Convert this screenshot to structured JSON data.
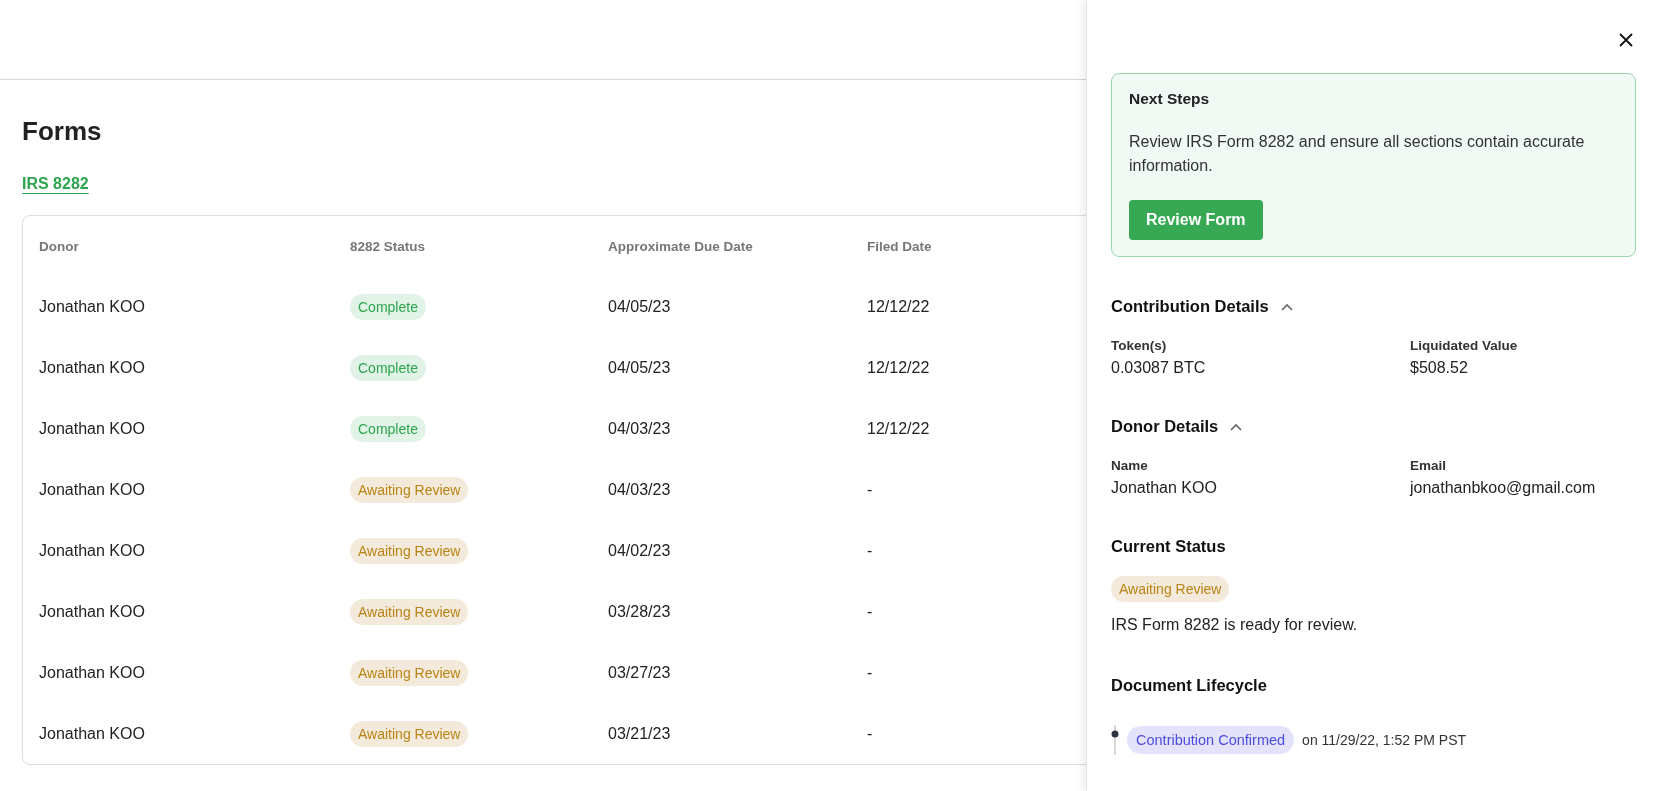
{
  "page": {
    "title": "Forms",
    "link": "IRS 8282"
  },
  "table": {
    "columns": [
      "Donor",
      "8282 Status",
      "Approximate Due Date",
      "Filed Date"
    ],
    "rows": [
      {
        "donor": "Jonathan KOO",
        "status": {
          "label": "Complete",
          "kind": "complete"
        },
        "due": "04/05/23",
        "filed": "12/12/22"
      },
      {
        "donor": "Jonathan KOO",
        "status": {
          "label": "Complete",
          "kind": "complete"
        },
        "due": "04/05/23",
        "filed": "12/12/22"
      },
      {
        "donor": "Jonathan KOO",
        "status": {
          "label": "Complete",
          "kind": "complete"
        },
        "due": "04/03/23",
        "filed": "12/12/22"
      },
      {
        "donor": "Jonathan KOO",
        "status": {
          "label": "Awaiting Review",
          "kind": "awaiting"
        },
        "due": "04/03/23",
        "filed": "-"
      },
      {
        "donor": "Jonathan KOO",
        "status": {
          "label": "Awaiting Review",
          "kind": "awaiting"
        },
        "due": "04/02/23",
        "filed": "-"
      },
      {
        "donor": "Jonathan KOO",
        "status": {
          "label": "Awaiting Review",
          "kind": "awaiting"
        },
        "due": "03/28/23",
        "filed": "-"
      },
      {
        "donor": "Jonathan KOO",
        "status": {
          "label": "Awaiting Review",
          "kind": "awaiting"
        },
        "due": "03/27/23",
        "filed": "-"
      },
      {
        "donor": "Jonathan KOO",
        "status": {
          "label": "Awaiting Review",
          "kind": "awaiting"
        },
        "due": "03/21/23",
        "filed": "-"
      }
    ]
  },
  "panel": {
    "next_steps": {
      "title": "Next Steps",
      "text": "Review IRS Form 8282 and ensure all sections contain accurate information.",
      "button": "Review Form"
    },
    "sections": [
      {
        "title": "Contribution Details",
        "expanded": true,
        "fields": [
          {
            "label": "Token(s)",
            "value": "0.03087 BTC"
          },
          {
            "label": "Liquidated Value",
            "value": "$508.52"
          }
        ]
      },
      {
        "title": "Donor Details",
        "expanded": true,
        "fields": [
          {
            "label": "Name",
            "value": "Jonathan KOO"
          },
          {
            "label": "Email",
            "value": "jonathanbkoo@gmail.com"
          }
        ]
      }
    ],
    "current_status": {
      "title": "Current Status",
      "badge": {
        "label": "Awaiting Review",
        "kind": "awaiting"
      },
      "text": "IRS Form 8282 is ready for review."
    },
    "lifecycle": {
      "title": "Document Lifecycle",
      "events": [
        {
          "label": "Contribution Confirmed",
          "text": "on 11/29/22, 1:52 PM PST"
        }
      ]
    }
  }
}
